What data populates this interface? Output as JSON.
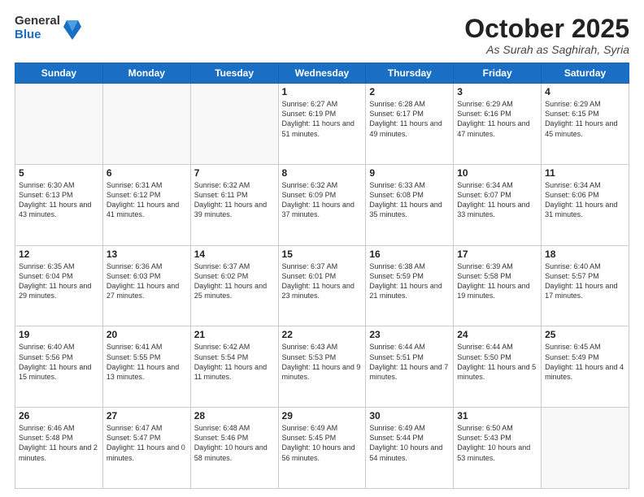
{
  "header": {
    "logo_general": "General",
    "logo_blue": "Blue",
    "month_title": "October 2025",
    "location": "As Surah as Saghirah, Syria"
  },
  "weekdays": [
    "Sunday",
    "Monday",
    "Tuesday",
    "Wednesday",
    "Thursday",
    "Friday",
    "Saturday"
  ],
  "weeks": [
    [
      {
        "day": "",
        "sunrise": "",
        "sunset": "",
        "daylight": ""
      },
      {
        "day": "",
        "sunrise": "",
        "sunset": "",
        "daylight": ""
      },
      {
        "day": "",
        "sunrise": "",
        "sunset": "",
        "daylight": ""
      },
      {
        "day": "1",
        "sunrise": "Sunrise: 6:27 AM",
        "sunset": "Sunset: 6:19 PM",
        "daylight": "Daylight: 11 hours and 51 minutes."
      },
      {
        "day": "2",
        "sunrise": "Sunrise: 6:28 AM",
        "sunset": "Sunset: 6:17 PM",
        "daylight": "Daylight: 11 hours and 49 minutes."
      },
      {
        "day": "3",
        "sunrise": "Sunrise: 6:29 AM",
        "sunset": "Sunset: 6:16 PM",
        "daylight": "Daylight: 11 hours and 47 minutes."
      },
      {
        "day": "4",
        "sunrise": "Sunrise: 6:29 AM",
        "sunset": "Sunset: 6:15 PM",
        "daylight": "Daylight: 11 hours and 45 minutes."
      }
    ],
    [
      {
        "day": "5",
        "sunrise": "Sunrise: 6:30 AM",
        "sunset": "Sunset: 6:13 PM",
        "daylight": "Daylight: 11 hours and 43 minutes."
      },
      {
        "day": "6",
        "sunrise": "Sunrise: 6:31 AM",
        "sunset": "Sunset: 6:12 PM",
        "daylight": "Daylight: 11 hours and 41 minutes."
      },
      {
        "day": "7",
        "sunrise": "Sunrise: 6:32 AM",
        "sunset": "Sunset: 6:11 PM",
        "daylight": "Daylight: 11 hours and 39 minutes."
      },
      {
        "day": "8",
        "sunrise": "Sunrise: 6:32 AM",
        "sunset": "Sunset: 6:09 PM",
        "daylight": "Daylight: 11 hours and 37 minutes."
      },
      {
        "day": "9",
        "sunrise": "Sunrise: 6:33 AM",
        "sunset": "Sunset: 6:08 PM",
        "daylight": "Daylight: 11 hours and 35 minutes."
      },
      {
        "day": "10",
        "sunrise": "Sunrise: 6:34 AM",
        "sunset": "Sunset: 6:07 PM",
        "daylight": "Daylight: 11 hours and 33 minutes."
      },
      {
        "day": "11",
        "sunrise": "Sunrise: 6:34 AM",
        "sunset": "Sunset: 6:06 PM",
        "daylight": "Daylight: 11 hours and 31 minutes."
      }
    ],
    [
      {
        "day": "12",
        "sunrise": "Sunrise: 6:35 AM",
        "sunset": "Sunset: 6:04 PM",
        "daylight": "Daylight: 11 hours and 29 minutes."
      },
      {
        "day": "13",
        "sunrise": "Sunrise: 6:36 AM",
        "sunset": "Sunset: 6:03 PM",
        "daylight": "Daylight: 11 hours and 27 minutes."
      },
      {
        "day": "14",
        "sunrise": "Sunrise: 6:37 AM",
        "sunset": "Sunset: 6:02 PM",
        "daylight": "Daylight: 11 hours and 25 minutes."
      },
      {
        "day": "15",
        "sunrise": "Sunrise: 6:37 AM",
        "sunset": "Sunset: 6:01 PM",
        "daylight": "Daylight: 11 hours and 23 minutes."
      },
      {
        "day": "16",
        "sunrise": "Sunrise: 6:38 AM",
        "sunset": "Sunset: 5:59 PM",
        "daylight": "Daylight: 11 hours and 21 minutes."
      },
      {
        "day": "17",
        "sunrise": "Sunrise: 6:39 AM",
        "sunset": "Sunset: 5:58 PM",
        "daylight": "Daylight: 11 hours and 19 minutes."
      },
      {
        "day": "18",
        "sunrise": "Sunrise: 6:40 AM",
        "sunset": "Sunset: 5:57 PM",
        "daylight": "Daylight: 11 hours and 17 minutes."
      }
    ],
    [
      {
        "day": "19",
        "sunrise": "Sunrise: 6:40 AM",
        "sunset": "Sunset: 5:56 PM",
        "daylight": "Daylight: 11 hours and 15 minutes."
      },
      {
        "day": "20",
        "sunrise": "Sunrise: 6:41 AM",
        "sunset": "Sunset: 5:55 PM",
        "daylight": "Daylight: 11 hours and 13 minutes."
      },
      {
        "day": "21",
        "sunrise": "Sunrise: 6:42 AM",
        "sunset": "Sunset: 5:54 PM",
        "daylight": "Daylight: 11 hours and 11 minutes."
      },
      {
        "day": "22",
        "sunrise": "Sunrise: 6:43 AM",
        "sunset": "Sunset: 5:53 PM",
        "daylight": "Daylight: 11 hours and 9 minutes."
      },
      {
        "day": "23",
        "sunrise": "Sunrise: 6:44 AM",
        "sunset": "Sunset: 5:51 PM",
        "daylight": "Daylight: 11 hours and 7 minutes."
      },
      {
        "day": "24",
        "sunrise": "Sunrise: 6:44 AM",
        "sunset": "Sunset: 5:50 PM",
        "daylight": "Daylight: 11 hours and 5 minutes."
      },
      {
        "day": "25",
        "sunrise": "Sunrise: 6:45 AM",
        "sunset": "Sunset: 5:49 PM",
        "daylight": "Daylight: 11 hours and 4 minutes."
      }
    ],
    [
      {
        "day": "26",
        "sunrise": "Sunrise: 6:46 AM",
        "sunset": "Sunset: 5:48 PM",
        "daylight": "Daylight: 11 hours and 2 minutes."
      },
      {
        "day": "27",
        "sunrise": "Sunrise: 6:47 AM",
        "sunset": "Sunset: 5:47 PM",
        "daylight": "Daylight: 11 hours and 0 minutes."
      },
      {
        "day": "28",
        "sunrise": "Sunrise: 6:48 AM",
        "sunset": "Sunset: 5:46 PM",
        "daylight": "Daylight: 10 hours and 58 minutes."
      },
      {
        "day": "29",
        "sunrise": "Sunrise: 6:49 AM",
        "sunset": "Sunset: 5:45 PM",
        "daylight": "Daylight: 10 hours and 56 minutes."
      },
      {
        "day": "30",
        "sunrise": "Sunrise: 6:49 AM",
        "sunset": "Sunset: 5:44 PM",
        "daylight": "Daylight: 10 hours and 54 minutes."
      },
      {
        "day": "31",
        "sunrise": "Sunrise: 6:50 AM",
        "sunset": "Sunset: 5:43 PM",
        "daylight": "Daylight: 10 hours and 53 minutes."
      },
      {
        "day": "",
        "sunrise": "",
        "sunset": "",
        "daylight": ""
      }
    ]
  ]
}
